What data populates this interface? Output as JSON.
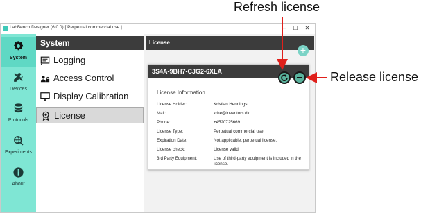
{
  "annotations": {
    "refresh": "Refresh license",
    "release": "Release license",
    "color": "#e0201b"
  },
  "window": {
    "title": "LabBench Designer (6.0.0) [ Perpetual commercial use ]",
    "controls": {
      "minimize": "–",
      "maximize": "☐",
      "close": "✕"
    }
  },
  "rail": [
    {
      "label": "System",
      "icon": "gear-icon",
      "active": true
    },
    {
      "label": "Devices",
      "icon": "tools-icon",
      "active": false
    },
    {
      "label": "Protocols",
      "icon": "database-icon",
      "active": false
    },
    {
      "label": "Experiments",
      "icon": "globe-icon",
      "active": false
    },
    {
      "label": "About",
      "icon": "info-icon",
      "active": false
    }
  ],
  "menu": {
    "header": "System",
    "items": [
      {
        "label": "Logging",
        "icon": "log-icon"
      },
      {
        "label": "Access Control",
        "icon": "users-lock-icon"
      },
      {
        "label": "Display Calibration",
        "icon": "monitor-icon"
      },
      {
        "label": "License",
        "icon": "certificate-icon",
        "active": true
      }
    ]
  },
  "content": {
    "header": "License",
    "add_label": "+",
    "license": {
      "key": "3S4A-9BH7-CJG2-6XLA",
      "info_title": "License Information",
      "rows": [
        {
          "key": "License Holder:",
          "value": "Kristian Hennings"
        },
        {
          "key": "Mail:",
          "value": "krhe@inventors.dk"
        },
        {
          "key": "Phone:",
          "value": "+4520725669"
        },
        {
          "key": "License Type:",
          "value": "Perpetual commercial use"
        },
        {
          "key": "Expiration Date:",
          "value": "Not applicable, perpetual license."
        },
        {
          "key": "License check:",
          "value": "License valid."
        },
        {
          "key": "3rd Party Equipment:",
          "value": "Use of third-party equipment is included in the license."
        }
      ]
    }
  },
  "colors": {
    "rail": "#7fe6d4",
    "header_dark": "#3c3c3c",
    "accent": "#5ab39d"
  }
}
